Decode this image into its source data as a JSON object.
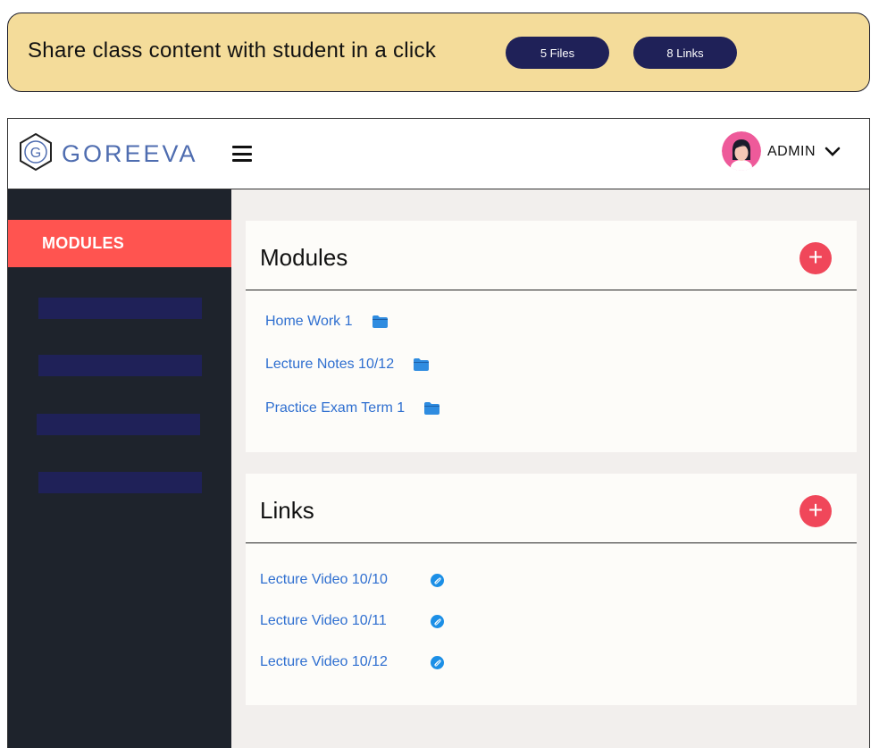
{
  "banner": {
    "title": "Share class content with student in a click",
    "files_label": "5 Files",
    "links_label": "8 Links"
  },
  "header": {
    "logo_text": "GOREEVA",
    "logo_letter": "G",
    "user_label": "ADMIN"
  },
  "sidebar": {
    "active_label": "MODULES"
  },
  "modules": {
    "title": "Modules",
    "add_label": "+",
    "items": [
      {
        "label": "Home Work 1"
      },
      {
        "label": "Lecture Notes 10/12"
      },
      {
        "label": "Practice Exam Term 1"
      }
    ]
  },
  "links": {
    "title": "Links",
    "add_label": "+",
    "items": [
      {
        "label": "Lecture Video 10/10"
      },
      {
        "label": "Lecture Video 10/11"
      },
      {
        "label": "Lecture Video 10/12"
      }
    ]
  },
  "colors": {
    "banner_bg": "#f4dc9a",
    "pill_bg": "#1f2158",
    "sidebar_bg": "#1e232c",
    "sidebar_active": "#ff5450",
    "add_button": "#f0475a",
    "link_text": "#2f6fd0",
    "logo_blue": "#4f6db0"
  }
}
